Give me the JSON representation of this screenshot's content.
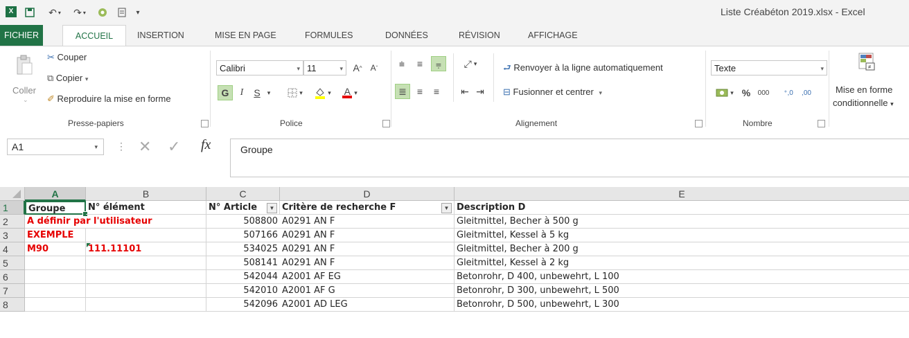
{
  "window": {
    "title": "Liste Créabéton 2019.xlsx - Excel"
  },
  "tabs": [
    {
      "label": "FICHIER"
    },
    {
      "label": "ACCUEIL"
    },
    {
      "label": "INSERTION"
    },
    {
      "label": "MISE EN PAGE"
    },
    {
      "label": "FORMULES"
    },
    {
      "label": "DONNÉES"
    },
    {
      "label": "RÉVISION"
    },
    {
      "label": "AFFICHAGE"
    }
  ],
  "ribbon": {
    "clipboard": {
      "paste": "Coller",
      "cut": "Couper",
      "copy": "Copier",
      "format_painter": "Reproduire la mise en forme",
      "group": "Presse-papiers"
    },
    "font": {
      "name": "Calibri",
      "size": "11",
      "bold": "G",
      "italic": "I",
      "underline": "S",
      "group": "Police"
    },
    "alignment": {
      "wrap": "Renvoyer à la ligne automatiquement",
      "merge": "Fusionner et centrer",
      "group": "Alignement"
    },
    "number": {
      "format": "Texte",
      "percent": "%",
      "thousands": "000",
      "inc_dec": ",0",
      "group": "Nombre"
    },
    "styles": {
      "cond_format_1": "Mise en forme",
      "cond_format_2": "conditionnelle"
    }
  },
  "formula_bar": {
    "name_box": "A1",
    "fx": "fx",
    "content": "Groupe"
  },
  "grid": {
    "columns": [
      "A",
      "B",
      "C",
      "D",
      "E"
    ],
    "rows": [
      "1",
      "2",
      "3",
      "4",
      "5",
      "6",
      "7",
      "8"
    ],
    "header": {
      "a": "Groupe",
      "b": "N° élément",
      "c": "N° Article",
      "d": "Critère de recherche F",
      "e": "Description D"
    },
    "data": [
      {
        "a": "A définir par l'utilisateur",
        "b": "",
        "c": "508800",
        "d": "A0291 AN F",
        "e": "Gleitmittel, Becher à 500 g"
      },
      {
        "a": "EXEMPLE",
        "b": "",
        "c": "507166",
        "d": "A0291 AN F",
        "e": "Gleitmittel, Kessel à 5 kg"
      },
      {
        "a": "M90",
        "b": "111.11101",
        "c": "534025",
        "d": "A0291 AN F",
        "e": "Gleitmittel, Becher à 200 g"
      },
      {
        "a": "",
        "b": "",
        "c": "508141",
        "d": "A0291 AN F",
        "e": "Gleitmittel, Kessel à 2 kg"
      },
      {
        "a": "",
        "b": "",
        "c": "542044",
        "d": "A2001 AF EG",
        "e": "Betonrohr, D 400, unbewehrt, L 100"
      },
      {
        "a": "",
        "b": "",
        "c": "542010",
        "d": "A2001 AF G",
        "e": "Betonrohr, D 300, unbewehrt, L 500"
      },
      {
        "a": "",
        "b": "",
        "c": "542096",
        "d": "A2001 AD LEG",
        "e": "Betonrohr, D 500, unbewehrt, L 300"
      }
    ]
  },
  "colors": {
    "excel_green": "#217346",
    "red_text": "#e60000"
  }
}
